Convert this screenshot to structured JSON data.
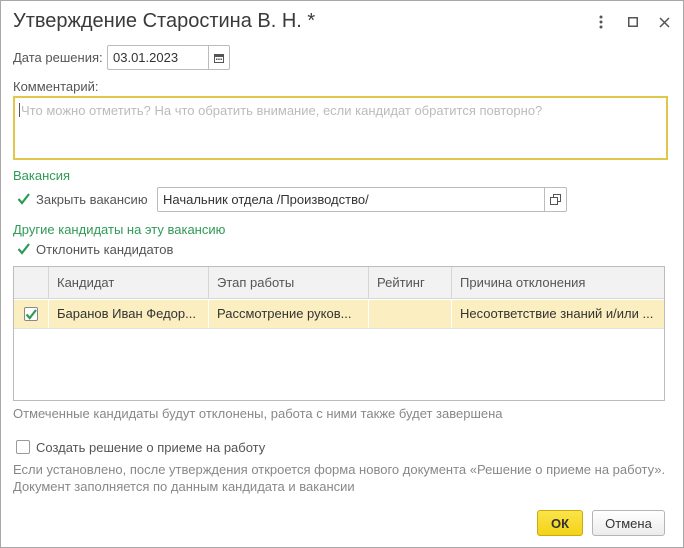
{
  "window": {
    "title": "Утверждение Старостина В. Н. *",
    "controls": [
      "more-icon",
      "maximize-icon",
      "close-icon"
    ]
  },
  "form": {
    "decision_date_label": "Дата решения:",
    "decision_date_value": "03.01.2023",
    "comment_label": "Комментарий:",
    "comment_placeholder": "Что можно отметить? На что обратить внимание, если кандидат обратится повторно?",
    "vacancy_section": "Вакансия",
    "close_vacancy_label": "Закрыть вакансию",
    "close_vacancy_checked": true,
    "vacancy_value": "Начальник отдела /Производство/",
    "other_candidates_section": "Другие кандидаты на эту вакансию",
    "reject_candidates_label": "Отклонить кандидатов",
    "reject_candidates_checked": true
  },
  "table": {
    "columns": [
      "Кандидат",
      "Этап работы",
      "Рейтинг",
      "Причина отклонения"
    ],
    "rows": [
      {
        "checked": true,
        "candidate": "Баранов Иван Федор...",
        "stage": "Рассмотрение руков...",
        "rating": "",
        "reason": "Несоответствие знаний и/или ..."
      }
    ]
  },
  "notes": {
    "rejected_note": "Отмеченные кандидаты будут отклонены, работа с ними также будет завершена",
    "create_hire_label": "Создать решение о приеме на работу",
    "create_hire_checked": false,
    "hire_note_line1": "Если установлено, после утверждения откроется форма нового документа «Решение о приеме на работу».",
    "hire_note_line2": "Документ заполняется по данным кандидата и вакансии"
  },
  "buttons": {
    "ok": "ОК",
    "cancel": "Отмена"
  },
  "colors": {
    "accent_green": "#2f9a55",
    "highlight_row": "#fbeec0",
    "focus_border": "#e0c64a",
    "ok_button": "#f3d217"
  }
}
